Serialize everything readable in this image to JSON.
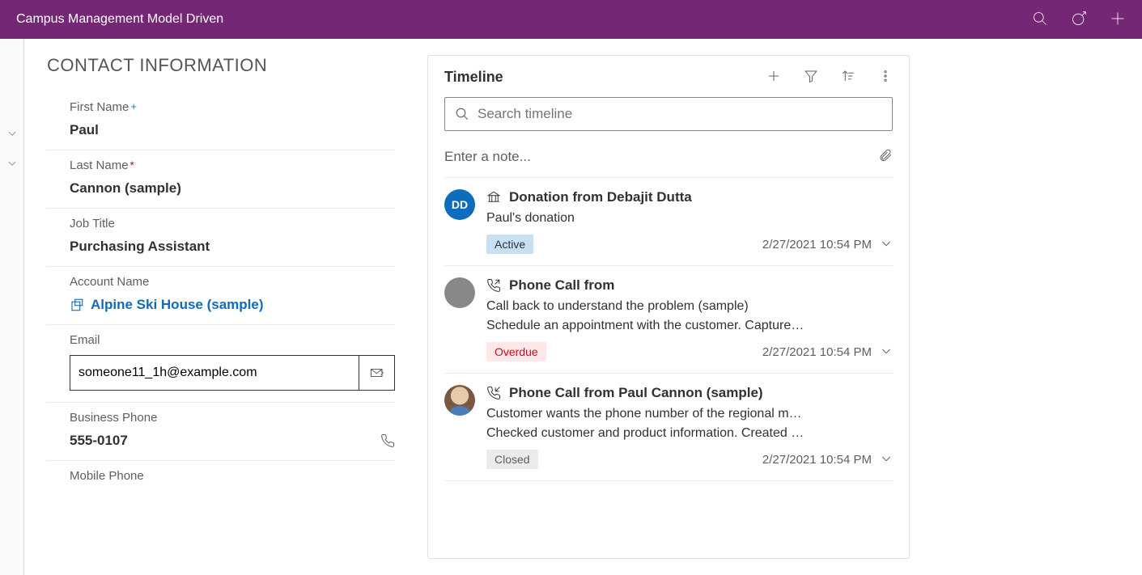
{
  "header": {
    "title": "Campus Management Model Driven"
  },
  "contact": {
    "section_title": "CONTACT INFORMATION",
    "labels": {
      "first_name": "First Name",
      "last_name": "Last Name",
      "job_title": "Job Title",
      "account_name": "Account Name",
      "email": "Email",
      "business_phone": "Business Phone",
      "mobile_phone": "Mobile Phone"
    },
    "values": {
      "first_name": "Paul",
      "last_name": "Cannon (sample)",
      "job_title": "Purchasing Assistant",
      "account_name": "Alpine Ski House (sample)",
      "email": "someone11_1h@example.com",
      "business_phone": "555-0107"
    }
  },
  "timeline": {
    "title": "Timeline",
    "search_placeholder": "Search timeline",
    "note_placeholder": "Enter a note...",
    "items": [
      {
        "avatar": "DD",
        "title": "Donation from Debajit Dutta",
        "desc1": "Paul's donation",
        "desc2": "",
        "status_label": "Active",
        "timestamp": "2/27/2021 10:54 PM"
      },
      {
        "avatar": "",
        "title": "Phone Call from",
        "desc1": "Call back to understand the problem (sample)",
        "desc2": "Schedule an appointment with the customer. Capture…",
        "status_label": "Overdue",
        "timestamp": "2/27/2021 10:54 PM"
      },
      {
        "avatar": "",
        "title": "Phone Call from Paul Cannon (sample)",
        "desc1": "Customer wants the phone number of the regional m…",
        "desc2": "Checked customer and product information. Created …",
        "status_label": "Closed",
        "timestamp": "2/27/2021 10:54 PM"
      }
    ]
  }
}
